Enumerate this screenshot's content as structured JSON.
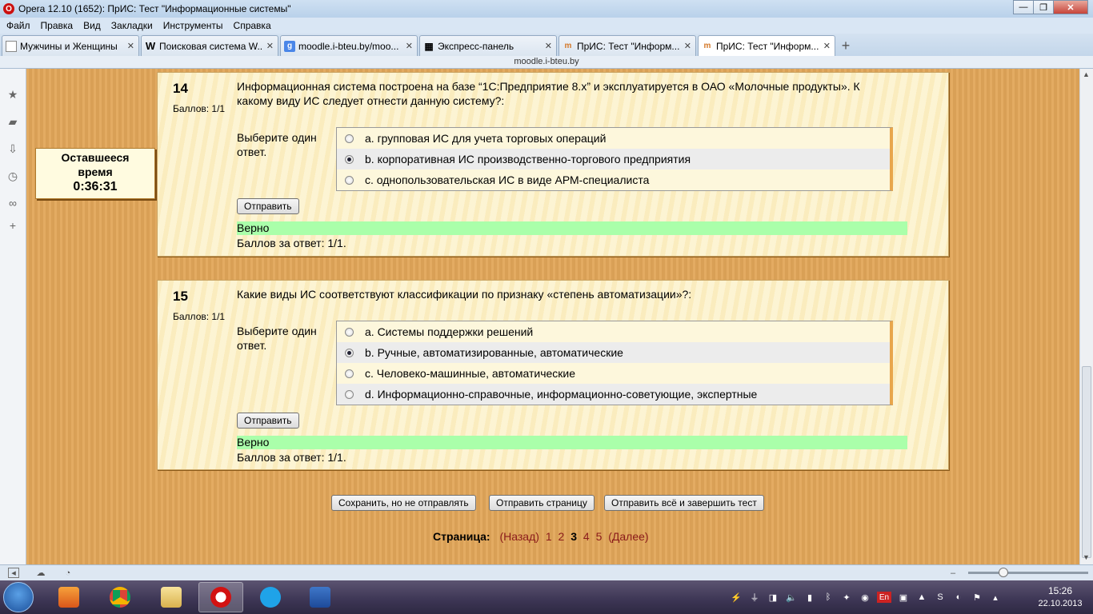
{
  "window": {
    "title": "Opera 12.10 (1652): ПрИС: Тест \"Информационные системы\"",
    "logo": "O"
  },
  "menu": [
    "Файл",
    "Правка",
    "Вид",
    "Закладки",
    "Инструменты",
    "Справка"
  ],
  "tabs": [
    {
      "label": "Мужчины и Женщины",
      "icon": "page-icon"
    },
    {
      "label": "Поисковая система W...",
      "icon": "W"
    },
    {
      "label": "moodle.i-bteu.by/moo...",
      "icon": "google-icon"
    },
    {
      "label": "Экспресс-панель",
      "icon": "speed-dial-icon"
    },
    {
      "label": "ПрИС: Тест \"Информ...",
      "icon": "moodle-icon"
    },
    {
      "label": "ПрИС: Тест \"Информ...",
      "icon": "moodle-icon"
    }
  ],
  "address": "moodle.i-bteu.by",
  "timer": {
    "line1": "Оставшееся",
    "line2": "время",
    "time": "0:36:31"
  },
  "questions": [
    {
      "number": "14",
      "grade": "Баллов: 1/1",
      "text": "Информационная система построена на базе “1С:Предприятие 8.х” и эксплуатируется в ОАО «Молочные продукты». К какому виду ИС следует отнести данную систему?:",
      "prompt": "Выберите один ответ.",
      "options": [
        {
          "label": "a. групповая ИС для учета торговых операций",
          "selected": false
        },
        {
          "label": "b. корпоративная ИС производственно-торгового предприятия",
          "selected": true
        },
        {
          "label": "c. однопользовательская ИС в виде АРМ-специалиста",
          "selected": false
        }
      ],
      "submit": "Отправить",
      "feedback": "Верно",
      "mark": "Баллов за ответ: 1/1."
    },
    {
      "number": "15",
      "grade": "Баллов: 1/1",
      "text": "Какие виды ИС соответствуют классификации по признаку «степень автоматизации»?:",
      "prompt": "Выберите один ответ.",
      "options": [
        {
          "label": "a. Системы поддержки решений",
          "selected": false
        },
        {
          "label": "b. Ручные, автоматизированные, автоматические",
          "selected": true
        },
        {
          "label": "c. Человеко-машинные, автоматические",
          "selected": false
        },
        {
          "label": "d. Информационно-справочные, информационно-советующие, экспертные",
          "selected": false
        }
      ],
      "submit": "Отправить",
      "feedback": "Верно",
      "mark": "Баллов за ответ: 1/1."
    }
  ],
  "actions": {
    "save": "Сохранить, но не отправлять",
    "submit_page": "Отправить страницу",
    "submit_all": "Отправить всё и завершить тест"
  },
  "paging": {
    "label": "Страница:",
    "prev": "(Назад)",
    "pages": [
      "1",
      "2",
      "3",
      "4",
      "5"
    ],
    "current": "3",
    "next": "(Далее)"
  },
  "taskbar": {
    "time": "15:26",
    "date": "22.10.2013",
    "lang": "En"
  },
  "colors": {
    "page_bg": "#e2a75a",
    "question_bg": "#fcf1c8",
    "correct_bg": "#aaffaa",
    "link": "#8a1a1a"
  }
}
